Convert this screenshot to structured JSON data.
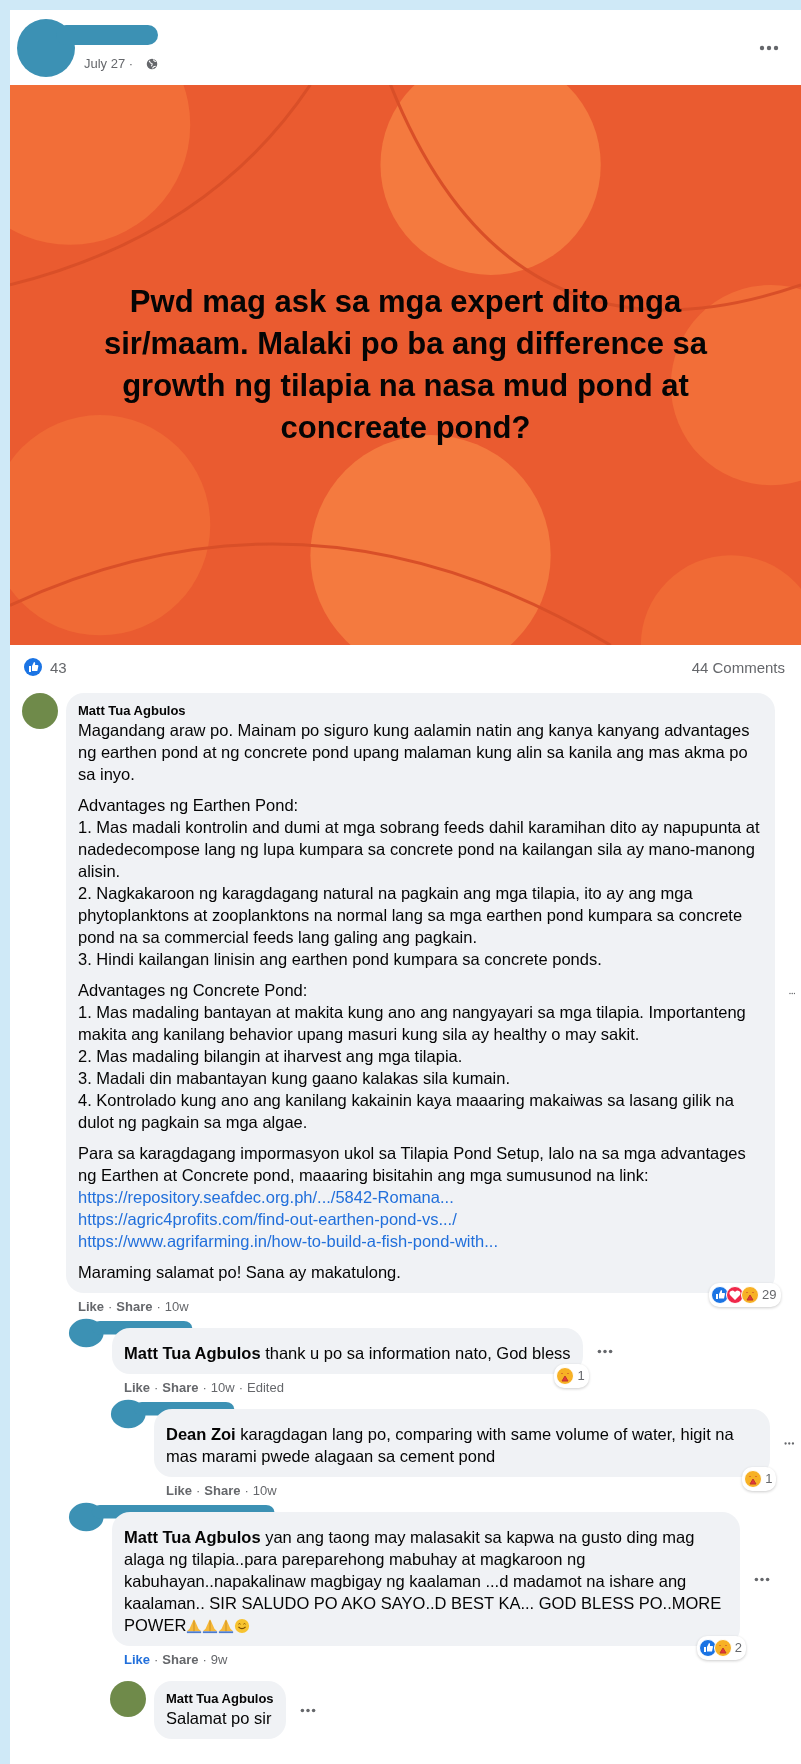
{
  "post": {
    "date": "July 27 ·",
    "text": "Pwd mag ask sa mga expert dito mga sir/maam. Malaki po ba ang difference sa growth ng tilapia na nasa mud pond at concreate pond?",
    "reaction_count": "43",
    "comment_count": "44 Comments"
  },
  "comments": [
    {
      "kind": "named",
      "author": "Matt Tua Agbulos",
      "paragraphs": [
        [
          {
            "kind": "text",
            "text": "Magandang araw po. Mainam po siguro kung aalamin natin ang kanya kanyang advantages ng earthen pond at ng concrete pond upang malaman kung alin sa kanila ang mas akma po sa inyo."
          }
        ],
        [
          {
            "kind": "text",
            "text": "Advantages ng Earthen Pond:"
          },
          {
            "kind": "text",
            "text": "1. Mas madali kontrolin and dumi at mga sobrang feeds dahil karamihan dito ay napupunta at nadedecompose lang ng lupa kumpara sa concrete pond na kailangan sila ay mano-manong alisin."
          },
          {
            "kind": "text",
            "text": "2. Nagkakaroon ng karagdagang natural na pagkain ang mga tilapia, ito ay ang mga phytoplanktons at zooplanktons na normal lang sa mga earthen pond kumpara sa concrete pond na sa commercial feeds lang galing ang pagkain."
          },
          {
            "kind": "text",
            "text": "3. Hindi kailangan linisin ang earthen pond kumpara sa concrete ponds."
          }
        ],
        [
          {
            "kind": "text",
            "text": "Advantages ng Concrete Pond:"
          },
          {
            "kind": "text",
            "text": "1. Mas madaling bantayan at makita kung ano ang nangyayari sa mga tilapia. Importanteng makita ang kanilang behavior upang masuri kung sila ay healthy o may sakit."
          },
          {
            "kind": "text",
            "text": "2. Mas madaling bilangin at iharvest ang mga tilapia."
          },
          {
            "kind": "text",
            "text": "3. Madali din mabantayan kung gaano kalakas sila kumain."
          },
          {
            "kind": "text",
            "text": "4. Kontrolado kung ano ang kanilang kakainin kaya maaaring makaiwas sa lasang gilik na dulot ng pagkain sa mga algae."
          }
        ],
        [
          {
            "kind": "text",
            "text": "Para sa karagdagang impormasyon ukol sa Tilapia Pond Setup, lalo na sa mga advantages ng Earthen at Concrete pond, maaaring bisitahin ang mga sumusunod na link:"
          },
          {
            "kind": "link",
            "text": "https://repository.seafdec.org.ph/.../5842-Romana..."
          },
          {
            "kind": "link",
            "text": "https://agric4profits.com/find-out-earthen-pond-vs.../"
          },
          {
            "kind": "link",
            "text": "https://www.agrifarming.in/how-to-build-a-fish-pond-with..."
          }
        ],
        [
          {
            "kind": "text",
            "text": "Maraming salamat po! Sana ay makatulong."
          }
        ]
      ],
      "reactions": {
        "types": [
          {
            "kind": "like"
          },
          {
            "kind": "love"
          },
          {
            "kind": "care"
          }
        ],
        "count": "29"
      },
      "actions": [
        {
          "kind": "like",
          "text": "Like"
        },
        {
          "kind": "sep",
          "text": "·"
        },
        {
          "kind": "share",
          "text": "Share"
        },
        {
          "kind": "sep",
          "text": "·"
        },
        {
          "kind": "meta",
          "text": "10w"
        }
      ],
      "liked": false,
      "children": [
        {
          "kind": "redacted",
          "paragraphs": [
            [
              {
                "kind": "text",
                "text": "**Matt Tua Agbulos** thank u po sa information nato, God bless"
              }
            ]
          ],
          "reactions": {
            "types": [
              {
                "kind": "care"
              }
            ],
            "count": "1"
          },
          "actions": [
            {
              "kind": "like",
              "text": "Like"
            },
            {
              "kind": "sep",
              "text": "·"
            },
            {
              "kind": "share",
              "text": "Share"
            },
            {
              "kind": "sep",
              "text": "·"
            },
            {
              "kind": "meta",
              "text": "10w"
            },
            {
              "kind": "sep",
              "text": "·"
            },
            {
              "kind": "meta",
              "text": "Edited"
            }
          ],
          "liked": false,
          "children": [
            {
              "kind": "redacted",
              "paragraphs": [
                [
                  {
                    "kind": "text",
                    "text": "**Dean Zoi** karagdagan lang po, comparing with same volume of water, higit na mas marami pwede alagaan sa cement pond"
                  }
                ]
              ],
              "reactions": {
                "types": [
                  {
                    "kind": "care"
                  }
                ],
                "count": "1"
              },
              "actions": [
                {
                  "kind": "like",
                  "text": "Like"
                },
                {
                  "kind": "sep",
                  "text": "·"
                },
                {
                  "kind": "share",
                  "text": "Share"
                },
                {
                  "kind": "sep",
                  "text": "·"
                },
                {
                  "kind": "meta",
                  "text": "10w"
                }
              ],
              "liked": false
            }
          ]
        },
        {
          "kind": "redacted",
          "paragraphs": [
            [
              {
                "kind": "text",
                "text": "**Matt Tua Agbulos** yan ang taong may malasakit sa kapwa na gusto ding mag alaga ng tilapia..para pareparehong mabuhay at magkaroon ng kabuhayan..napakalinaw magbigay ng kaalaman ...d madamot na ishare ang kaalaman.. SIR SALUDO PO AKO SAYO..D BEST KA... GOD BLESS PO..MORE POWER"
              }
            ]
          ],
          "emojis": [
            {
              "kind": "pray"
            },
            {
              "kind": "pray"
            },
            {
              "kind": "pray"
            },
            {
              "kind": "smile"
            }
          ],
          "reactions": {
            "types": [
              {
                "kind": "like"
              },
              {
                "kind": "care"
              }
            ],
            "count": "2"
          },
          "actions": [
            {
              "kind": "like",
              "text": "Like"
            },
            {
              "kind": "sep",
              "text": "·"
            },
            {
              "kind": "share",
              "text": "Share"
            },
            {
              "kind": "sep",
              "text": "·"
            },
            {
              "kind": "meta",
              "text": "9w"
            }
          ],
          "liked": true,
          "children": [
            {
              "kind": "named",
              "author": "Matt Tua Agbulos",
              "paragraphs": [
                [
                  {
                    "kind": "text",
                    "text": "Salamat po sir"
                  }
                ]
              ]
            }
          ]
        }
      ]
    }
  ]
}
